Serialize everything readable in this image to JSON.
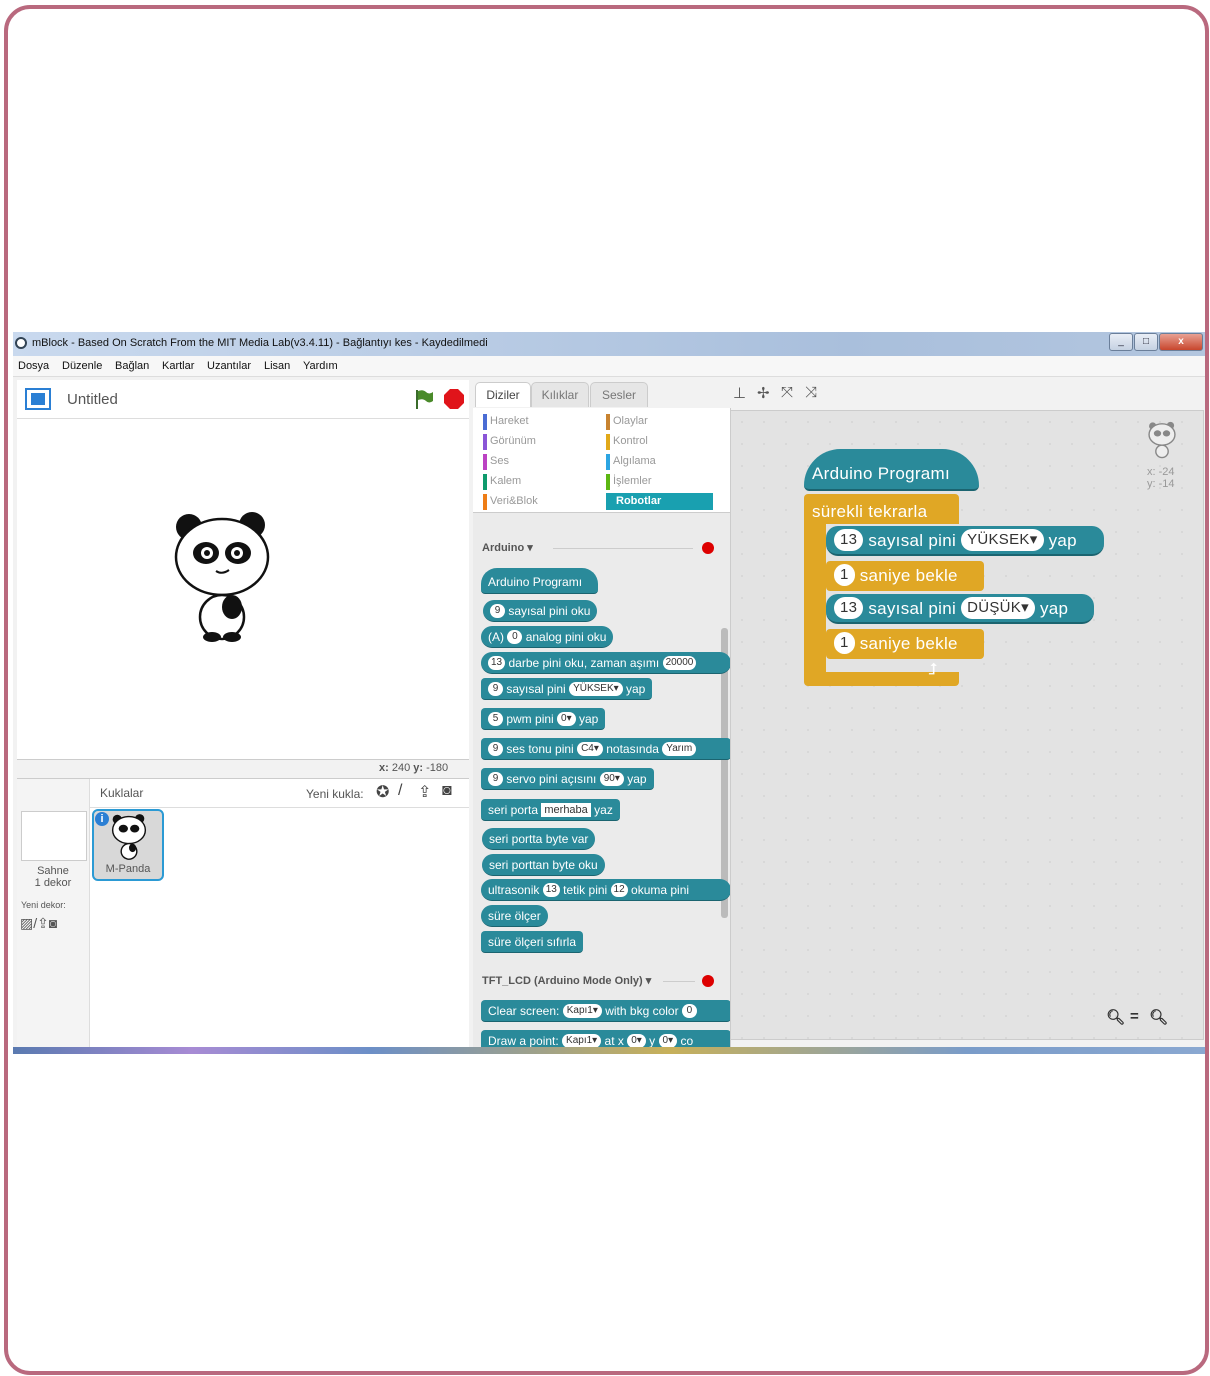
{
  "window": {
    "title": "mBlock - Based On Scratch From the MIT Media Lab(v3.4.11) - Bağlantıyı kes - Kaydedilmedi",
    "buttons": {
      "minimize": "_",
      "maximize": "□",
      "close": "x"
    }
  },
  "menu": [
    "Dosya",
    "Düzenle",
    "Bağlan",
    "Kartlar",
    "Uzantılar",
    "Lisan",
    "Yardım"
  ],
  "stage": {
    "project_title": "Untitled",
    "coords": {
      "x_label": "x:",
      "x_value": "240",
      "y_label": "y:",
      "y_value": "-180"
    }
  },
  "sprites": {
    "header": "Kuklalar",
    "new_sprite_label": "Yeni kukla:",
    "stage_label_1": "Sahne",
    "stage_label_2": "1 dekor",
    "new_backdrop_label": "Yeni dekor:",
    "sprite_name": "M-Panda",
    "info_badge": "i"
  },
  "tabs": [
    "Diziler",
    "Kılıklar",
    "Sesler"
  ],
  "categories": {
    "left": [
      {
        "label": "Hareket",
        "color": "#4a6cd4"
      },
      {
        "label": "Görünüm",
        "color": "#8a55d7"
      },
      {
        "label": "Ses",
        "color": "#bb42c3"
      },
      {
        "label": "Kalem",
        "color": "#0e9a6c"
      },
      {
        "label": "Veri&Blok",
        "color": "#ee7d16"
      }
    ],
    "right": [
      {
        "label": "Olaylar",
        "color": "#c88330"
      },
      {
        "label": "Kontrol",
        "color": "#e1a91a"
      },
      {
        "label": "Algılama",
        "color": "#2ca5e2"
      },
      {
        "label": "İşlemler",
        "color": "#5cb712"
      },
      {
        "label": "Robotlar",
        "color": "#19a0b0"
      }
    ]
  },
  "palette": {
    "section_arduino": "Arduino ▾",
    "section_tft": "TFT_LCD (Arduino Mode Only) ▾",
    "b_prog": "Arduino Programı",
    "b1_n": "9",
    "b1_t": "sayısal pini oku",
    "b2_a": "(A)",
    "b2_n": "0",
    "b2_t": "analog pini oku",
    "b3_n": "13",
    "b3_t": "darbe pini oku, zaman aşımı",
    "b3_v": "20000",
    "b4_n": "9",
    "b4_t": "sayısal pini",
    "b4_s": "YÜKSEK▾",
    "b4_e": "yap",
    "b5_n": "5",
    "b5_t": "pwm pini",
    "b5_s": "0▾",
    "b5_e": "yap",
    "b6_n": "9",
    "b6_t": "ses tonu pini",
    "b6_s": "C4▾",
    "b6_m": "notasında",
    "b6_v": "Yarım",
    "b7_n": "9",
    "b7_t": "servo pini açısını",
    "b7_s": "90▾",
    "b7_e": "yap",
    "b8_t": "seri porta",
    "b8_v": "merhaba",
    "b8_e": "yaz",
    "b9_t": "seri portta byte var",
    "b10_t": "seri porttan byte oku",
    "b11_t": "ultrasonik",
    "b11_n1": "13",
    "b11_m": "tetik pini",
    "b11_n2": "12",
    "b11_e": "okuma pini",
    "b12_t": "süre ölçer",
    "b13_t": "süre ölçeri sıfırla",
    "b14_t": "Clear screen:",
    "b14_s": "Kapı1▾",
    "b14_m": "with bkg color",
    "b14_v": "0",
    "b15_t": "Draw a point:",
    "b15_s": "Kapı1▾",
    "b15_m": "at x",
    "b15_x": "0▾",
    "b15_y": "y",
    "b15_y2": "0▾",
    "b15_e": "co"
  },
  "script": {
    "hat": "Arduino Programı",
    "loop": "sürekli tekrarla",
    "s1_n": "13",
    "s1_t": "sayısal pini",
    "s1_s": "YÜKSEK▾",
    "s1_e": "yap",
    "s2_n": "1",
    "s2_t": "saniye bekle",
    "s3_n": "13",
    "s3_t": "sayısal pini",
    "s3_s": "DÜŞÜK▾",
    "s3_e": "yap",
    "s4_n": "1",
    "s4_t": "saniye bekle",
    "sprite_x": "x: -24",
    "sprite_y": "y: -14",
    "zoom_reset": "="
  }
}
